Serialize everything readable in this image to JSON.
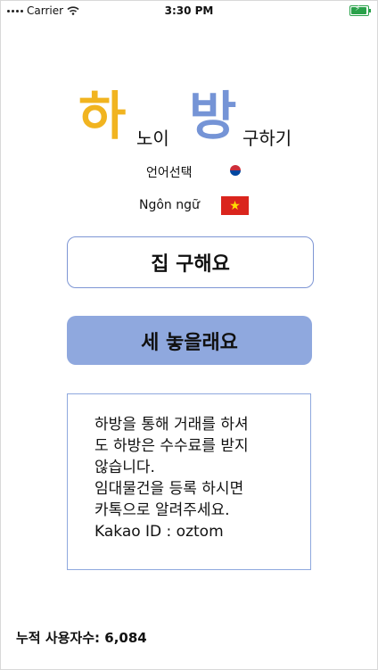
{
  "status_bar": {
    "carrier": "Carrier",
    "time": "3:30 PM",
    "battery_level": 0.85
  },
  "logo": {
    "ha": "하",
    "noi": "노이",
    "bang": "방",
    "guhagi": "구하기",
    "ha_color": "#f1b420",
    "bang_color": "#7594d6"
  },
  "language": {
    "korean_label": "언어선택",
    "vietnamese_label": "Ngôn ngữ"
  },
  "buttons": {
    "find_house": "집 구해요",
    "rent_out": "세 놓을래요"
  },
  "notice": {
    "lines": [
      "하방을 통해 거래를 하셔",
      "도 하방은 수수료를 받지",
      "않습니다.",
      "임대물건을 등록 하시면",
      "카톡으로 알려주세요.",
      "Kakao ID : oztom"
    ]
  },
  "footer": {
    "counter_label": "누적 사용자수:",
    "counter_value": "6,084"
  }
}
